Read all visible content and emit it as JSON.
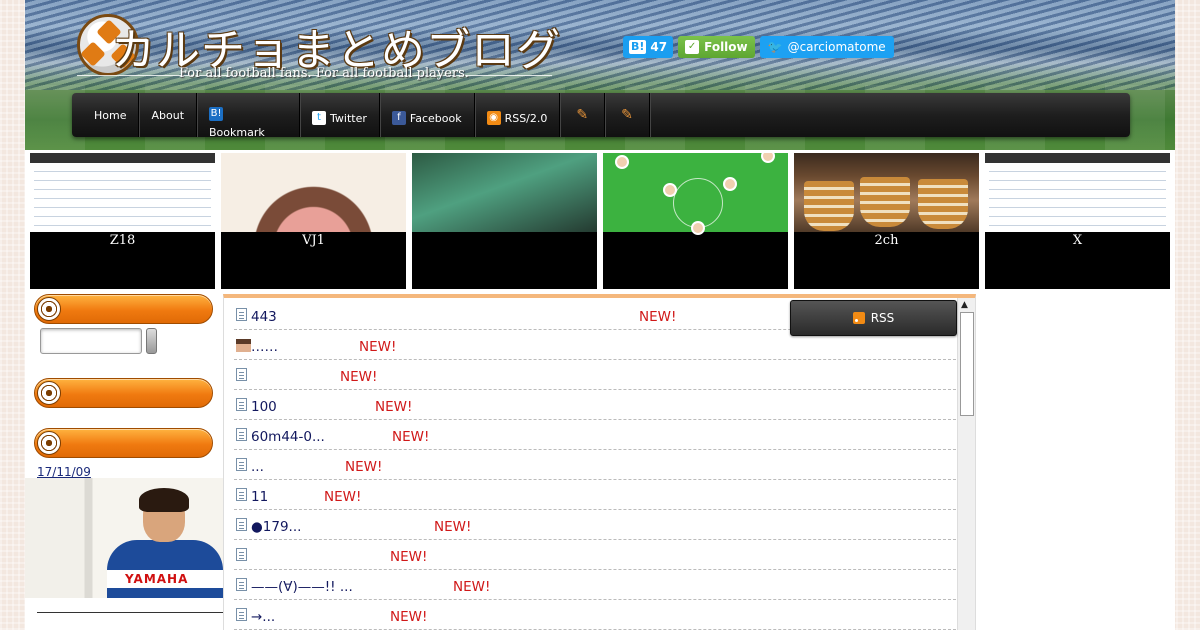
{
  "header": {
    "site_title": "カルチョまとめブログ",
    "tagline": "For all football fans.  For all football players.",
    "hatena_count": "47",
    "hatena_label": "B!",
    "follow_label": "Follow",
    "twitter_handle": "@carciomatome"
  },
  "nav": {
    "items": [
      {
        "label": "Home",
        "icon": ""
      },
      {
        "label": "About",
        "icon": ""
      },
      {
        "label": "Bookmark",
        "icon": "hatena-bookmark-icon"
      },
      {
        "label": "Twitter",
        "icon": "twitter-icon"
      },
      {
        "label": "Facebook",
        "icon": "facebook-icon"
      },
      {
        "label": "RSS/2.0",
        "icon": "rss-icon"
      },
      {
        "label": "",
        "icon": "pencil-icon"
      },
      {
        "label": "",
        "icon": "pencil-icon"
      }
    ]
  },
  "thumbs": [
    {
      "caption": "Z18",
      "image": "table-screenshot"
    },
    {
      "caption": "VJ1",
      "image": "cartoon-face"
    },
    {
      "caption": "",
      "image": "game-screenshot"
    },
    {
      "caption": "",
      "image": "football-formation"
    },
    {
      "caption": "2ch",
      "image": "stacked-bowls"
    },
    {
      "caption": "X",
      "image": "table-screenshot"
    }
  ],
  "sidebar": {
    "search_placeholder": "",
    "date_link": "17/11/09",
    "photo_sponsor": "YAMAHA"
  },
  "entries": [
    {
      "title": "443",
      "new": "NEW!",
      "icon": "document-icon"
    },
    {
      "title": "……",
      "new": "NEW!",
      "icon": "avatar-icon"
    },
    {
      "title": "",
      "new": "NEW!",
      "icon": "document-icon"
    },
    {
      "title": "100",
      "new": "NEW!",
      "icon": "document-icon"
    },
    {
      "title": "60m44-0...",
      "new": "NEW!",
      "icon": "document-icon"
    },
    {
      "title": "...",
      "new": "NEW!",
      "icon": "document-icon"
    },
    {
      "title": "11",
      "new": "NEW!",
      "icon": "document-icon"
    },
    {
      "title": "●179...",
      "new": "NEW!",
      "icon": "document-icon"
    },
    {
      "title": "",
      "new": "NEW!",
      "icon": "document-icon"
    },
    {
      "title": " ——(∀)——!! ...",
      "new": "NEW!",
      "icon": "document-icon"
    },
    {
      "title": "→...",
      "new": "NEW!",
      "icon": "document-icon"
    }
  ],
  "rss_button": "RSS",
  "colors": {
    "accent_orange": "#f07a10",
    "new_red": "#d01818",
    "link_navy": "#12185e"
  }
}
